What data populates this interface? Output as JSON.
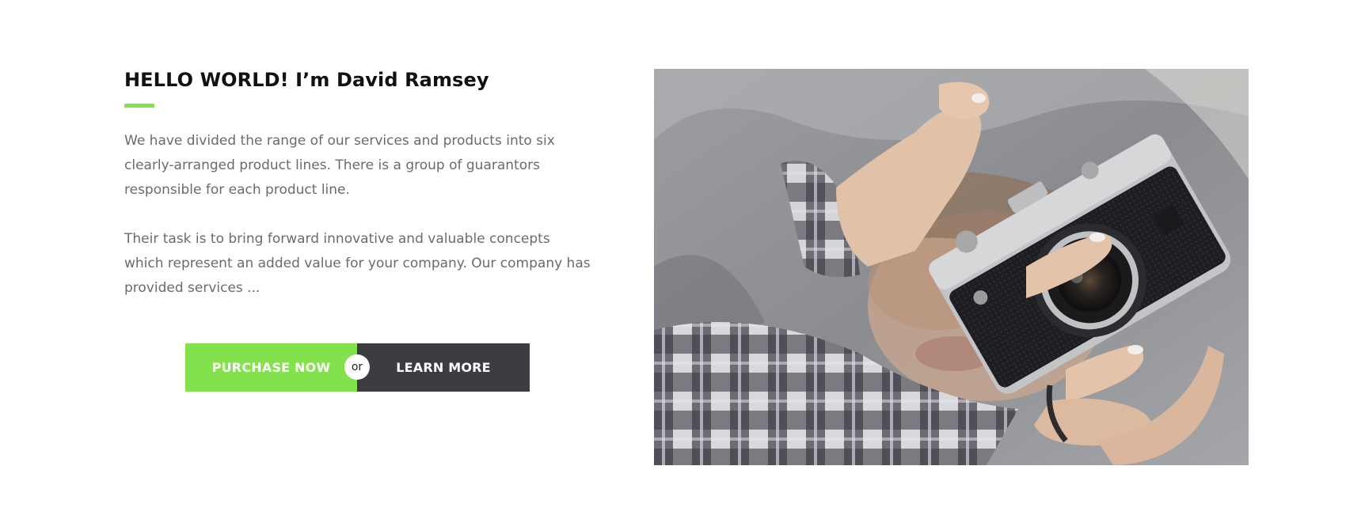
{
  "intro": {
    "title": "HELLO WORLD! I’m David Ramsey",
    "paragraphs": [
      "We have divided the range of our services and products into six clearly-arranged product lines. There is a group of guarantors responsible for each product line.",
      "Their task is to bring forward innovative and valuable concepts which represent an added value for your company. Our company has provided services ..."
    ]
  },
  "cta": {
    "purchase_label": "PURCHASE NOW",
    "separator": "or",
    "learn_label": "LEARN MORE"
  },
  "colors": {
    "accent": "#83e14c",
    "dark_button": "#3b3d42",
    "heading": "#111111",
    "body_text": "#6b6b6b"
  },
  "photo": {
    "subject": "person holding a vintage camera"
  }
}
